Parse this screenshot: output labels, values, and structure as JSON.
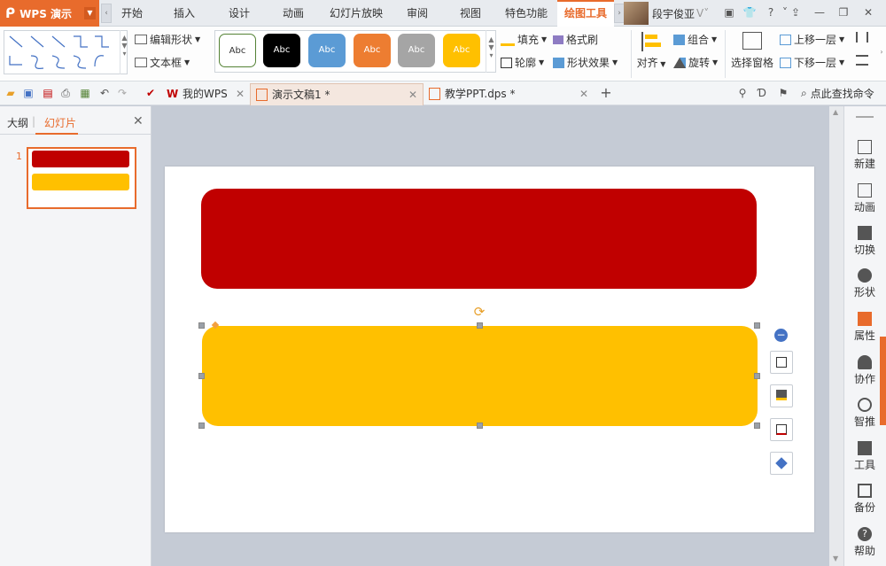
{
  "app": {
    "name": "WPS 演示"
  },
  "menu": {
    "tabs": [
      "开始",
      "插入",
      "设计",
      "动画",
      "幻灯片放映",
      "审阅",
      "视图",
      "特色功能",
      "绘图工具"
    ],
    "user": "段宇俊亚"
  },
  "ribbon": {
    "edit_shape": "编辑形状",
    "text_box": "文本框",
    "style_labels": [
      "Abc",
      "Abc",
      "Abc",
      "Abc",
      "Abc",
      "Abc"
    ],
    "fill": "填充",
    "format_painter": "格式刷",
    "outline": "轮廓",
    "shape_effect": "形状效果",
    "align": "对齐",
    "group": "组合",
    "rotate": "旋转",
    "selection_pane": "选择窗格",
    "bring_forward": "上移一层",
    "send_backward": "下移一层"
  },
  "quickbar": {
    "tabs": [
      {
        "label": "我的WPS"
      },
      {
        "label": "演示文稿1 *"
      },
      {
        "label": "教学PPT.dps *"
      }
    ],
    "search": "点此查找命令"
  },
  "leftpane": {
    "outline_tab": "大纲",
    "slides_tab": "幻灯片",
    "slide_number": "1"
  },
  "rightbar": {
    "items": [
      "新建",
      "动画",
      "切换",
      "形状",
      "属性",
      "协作",
      "智推",
      "工具",
      "备份",
      "帮助"
    ]
  },
  "colors": {
    "accent": "#e86b2c",
    "shape_red": "#c00000",
    "shape_yellow": "#ffc000"
  }
}
